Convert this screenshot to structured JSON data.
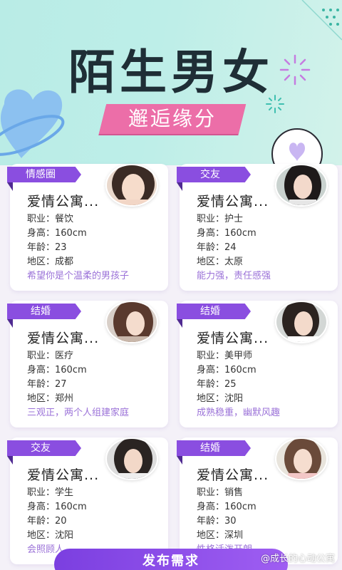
{
  "banner": {
    "title": "陌生男女",
    "subtitle": "邂逅缘分"
  },
  "cards": [
    {
      "tag": "情感圈",
      "name": "爱情公寓...",
      "job": "职业：餐饮",
      "height": "身高：160cm",
      "age": "年龄：23",
      "area": "地区：成都",
      "motto": "希望你是个温柔的男孩子"
    },
    {
      "tag": "交友",
      "name": "爱情公寓...",
      "job": "职业：护士",
      "height": "身高：160cm",
      "age": "年龄：24",
      "area": "地区：太原",
      "motto": "能力强，责任感强"
    },
    {
      "tag": "结婚",
      "name": "爱情公寓...",
      "job": "职业：医疗",
      "height": "身高：160cm",
      "age": "年龄：27",
      "area": "地区：郑州",
      "motto": "三观正，两个人组建家庭"
    },
    {
      "tag": "结婚",
      "name": "爱情公寓...",
      "job": "职业：美甲师",
      "height": "身高：160cm",
      "age": "年龄：25",
      "area": "地区：沈阳",
      "motto": "成熟稳重，幽默风趣"
    },
    {
      "tag": "交友",
      "name": "爱情公寓...",
      "job": "职业：学生",
      "height": "身高：160cm",
      "age": "年龄：20",
      "area": "地区：沈阳",
      "motto": "会照顾人"
    },
    {
      "tag": "结婚",
      "name": "爱情公寓...",
      "job": "职业：销售",
      "height": "身高：160cm",
      "age": "年龄：30",
      "area": "地区：深圳",
      "motto": "性格活泼开朗"
    }
  ],
  "publish_label": "发布需求",
  "watermark": "@成长的心动公寓",
  "colors": {
    "accent": "#8a4ee0",
    "pink": "#ec6ea8",
    "banner_bg": "#bdeee8"
  }
}
